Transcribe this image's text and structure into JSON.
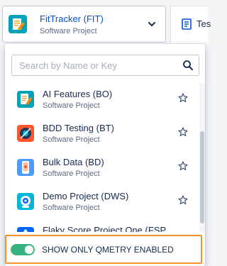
{
  "selected_project": {
    "name": "FitTracker (FIT)",
    "type": "Software Project",
    "icon": "notepad-pencil-icon"
  },
  "tab": {
    "label": "Tes",
    "icon": "document-icon"
  },
  "search": {
    "placeholder": "Search by Name or Key",
    "value": ""
  },
  "projects": [
    {
      "name": "AI Features (BO)",
      "type": "Software Project",
      "icon": "notepad-icon"
    },
    {
      "name": "BDD Testing (BT)",
      "type": "Software Project",
      "icon": "record-icon"
    },
    {
      "name": "Bulk Data (BD)",
      "type": "Software Project",
      "icon": "phone-icon"
    },
    {
      "name": "Demo Project (DWS)",
      "type": "Software Project",
      "icon": "robot-icon"
    },
    {
      "name": "Flaky Score Project One (FSP...",
      "type": "",
      "icon": "rocket-icon"
    }
  ],
  "toggle": {
    "label": "SHOW ONLY QMETRY ENABLED",
    "enabled": true
  },
  "colors": {
    "accent_blue": "#0052cc",
    "toggle_green": "#36b37e",
    "highlight_orange": "#f79232"
  }
}
